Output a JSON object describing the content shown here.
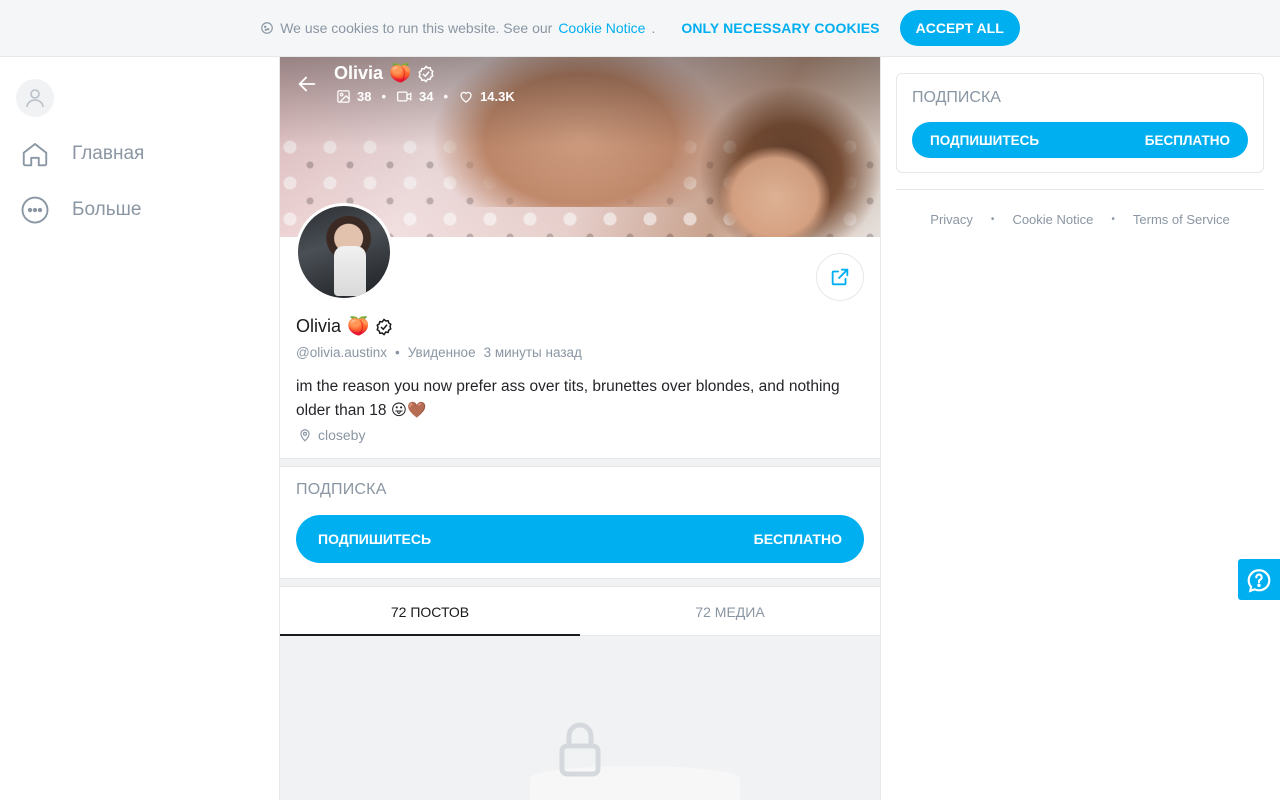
{
  "cookie_bar": {
    "text": "We use cookies to run this website. See our",
    "link": "Cookie Notice",
    "period": ".",
    "necessary_label": "ONLY NECESSARY COOKIES",
    "accept_label": "ACCEPT ALL"
  },
  "sidebar": {
    "items": [
      {
        "label": "Главная",
        "icon": "home-icon"
      },
      {
        "label": "Больше",
        "icon": "more-icon"
      }
    ]
  },
  "cover": {
    "name": "Olivia",
    "stats": {
      "photos": "38",
      "videos": "34",
      "likes": "14.3K"
    }
  },
  "profile": {
    "name": "Olivia",
    "handle": "@olivia.austinx",
    "seen_label": "Увиденное",
    "seen_time": "3 минуты назад",
    "bio": "im the reason you now prefer ass over tits, brunettes over blondes, and nothing older than 18 😛🤎",
    "location": "closeby"
  },
  "subscription": {
    "title": "ПОДПИСКА",
    "button_label": "ПОДПИШИТЕСЬ",
    "button_price": "БЕСПЛАТНО"
  },
  "tabs": [
    {
      "label": "72 ПОСТОВ",
      "active": true
    },
    {
      "label": "72 МЕДИА",
      "active": false
    }
  ],
  "right_panel": {
    "title": "ПОДПИСКА",
    "button_label": "ПОДПИШИТЕСЬ",
    "button_price": "БЕСПЛАТНО"
  },
  "footer": {
    "links": [
      "Privacy",
      "Cookie Notice",
      "Terms of Service"
    ]
  },
  "colors": {
    "accent": "#00aff0",
    "muted": "#8a96a3"
  }
}
